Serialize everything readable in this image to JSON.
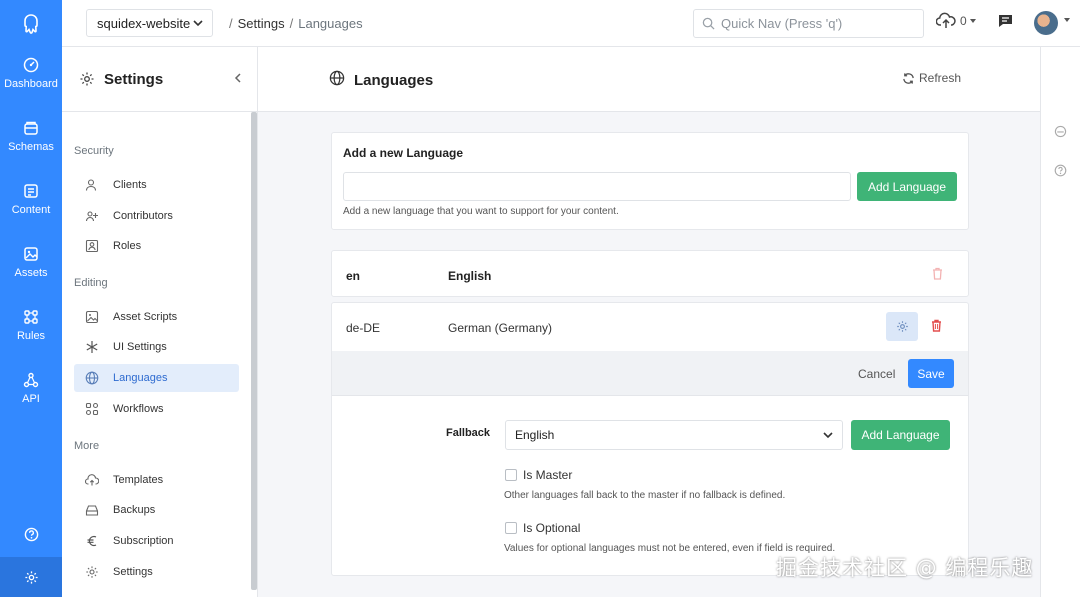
{
  "rail": {
    "items": [
      {
        "label": "Dashboard",
        "icon": "dashboard-icon"
      },
      {
        "label": "Schemas",
        "icon": "schemas-icon"
      },
      {
        "label": "Content",
        "icon": "content-icon"
      },
      {
        "label": "Assets",
        "icon": "assets-icon"
      },
      {
        "label": "Rules",
        "icon": "rules-icon"
      },
      {
        "label": "API",
        "icon": "api-icon"
      }
    ],
    "help_icon": "help-icon",
    "settings_icon": "settings-gear-icon"
  },
  "topbar": {
    "app_name": "squidex-website",
    "breadcrumb": {
      "parent": "Settings",
      "current": "Languages",
      "separator": "/"
    },
    "quicknav_placeholder": "Quick Nav (Press 'q')",
    "upload_count": "0"
  },
  "sidebar": {
    "title": "Settings",
    "groups": [
      {
        "label": "Security",
        "items": [
          {
            "label": "Clients",
            "icon": "clients-icon"
          },
          {
            "label": "Contributors",
            "icon": "contributors-icon"
          },
          {
            "label": "Roles",
            "icon": "roles-icon"
          }
        ]
      },
      {
        "label": "Editing",
        "items": [
          {
            "label": "Asset Scripts",
            "icon": "asset-scripts-icon"
          },
          {
            "label": "UI Settings",
            "icon": "asterisk-icon"
          },
          {
            "label": "Languages",
            "icon": "globe-icon",
            "active": true
          },
          {
            "label": "Workflows",
            "icon": "workflows-icon"
          }
        ]
      },
      {
        "label": "More",
        "items": [
          {
            "label": "Templates",
            "icon": "cloud-icon"
          },
          {
            "label": "Backups",
            "icon": "backups-icon"
          },
          {
            "label": "Subscription",
            "icon": "euro-icon"
          },
          {
            "label": "Settings",
            "icon": "gear-icon"
          }
        ]
      }
    ]
  },
  "main": {
    "title": "Languages",
    "refresh_label": "Refresh",
    "add_card": {
      "label": "Add a new Language",
      "input_value": "",
      "button_label": "Add Language",
      "hint": "Add a new language that you want to support for your content."
    },
    "languages": [
      {
        "code": "en",
        "name": "English"
      },
      {
        "code": "de-DE",
        "name": "German (Germany)"
      }
    ],
    "editor": {
      "cancel_label": "Cancel",
      "save_label": "Save",
      "fallback_label": "Fallback",
      "fallback_value": "English",
      "add_button_label": "Add Language",
      "is_master_label": "Is Master",
      "is_master_hint": "Other languages fall back to the master if no fallback is defined.",
      "is_optional_label": "Is Optional",
      "is_optional_hint": "Values for optional languages must not be entered, even if field is required."
    }
  },
  "watermark": "掘金技术社区 @ 编程乐趣",
  "colors": {
    "rail_blue": "#3389ff",
    "green_button": "#3fb477",
    "save_blue": "#3389ff",
    "danger_red": "#e34e4e",
    "active_item_bg": "#e3edfb"
  }
}
